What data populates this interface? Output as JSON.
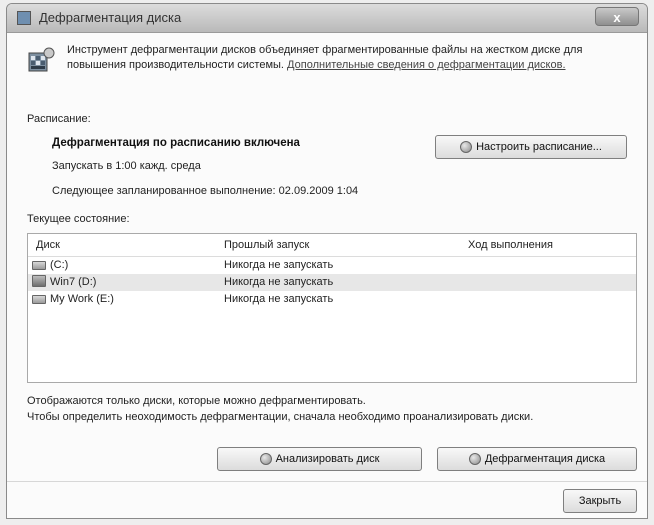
{
  "window": {
    "title": "Дефрагментация диска",
    "close_glyph": "x"
  },
  "intro": {
    "text": "Инструмент дефрагментации дисков объединяет фрагментированные файлы на жестком диске для повышения производительности системы. ",
    "link": "Дополнительные сведения о дефрагментации дисков."
  },
  "schedule": {
    "label": "Расписание:",
    "status": "Дефрагментация по расписанию включена",
    "runs": "Запускать в 1:00 кажд. среда",
    "next_run": "Следующее запланированное выполнение: 02.09.2009 1:04",
    "configure_button": "Настроить расписание..."
  },
  "current_state": {
    "label": "Текущее состояние:",
    "columns": {
      "disk": "Диск",
      "last_run": "Прошлый запуск",
      "progress": "Ход выполнения"
    },
    "disks": [
      {
        "name": "(C:)",
        "last_run": "Никогда не запускать",
        "progress": "",
        "icon": "drive-icon"
      },
      {
        "name": "Win7 (D:)",
        "last_run": "Никогда не запускать",
        "progress": "",
        "icon": "system-drive-icon"
      },
      {
        "name": "My Work (E:)",
        "last_run": "Никогда не запускать",
        "progress": "",
        "icon": "drive-icon"
      }
    ]
  },
  "notes": {
    "line1": "Отображаются только диски, которые можно дефрагментировать.",
    "line2": "Чтобы определить неоходимость  дефрагментации, сначала необходимо проанализировать диски."
  },
  "buttons": {
    "analyze": "Анализировать диск",
    "defragment": "Дефрагментация диска",
    "close": "Закрыть"
  }
}
